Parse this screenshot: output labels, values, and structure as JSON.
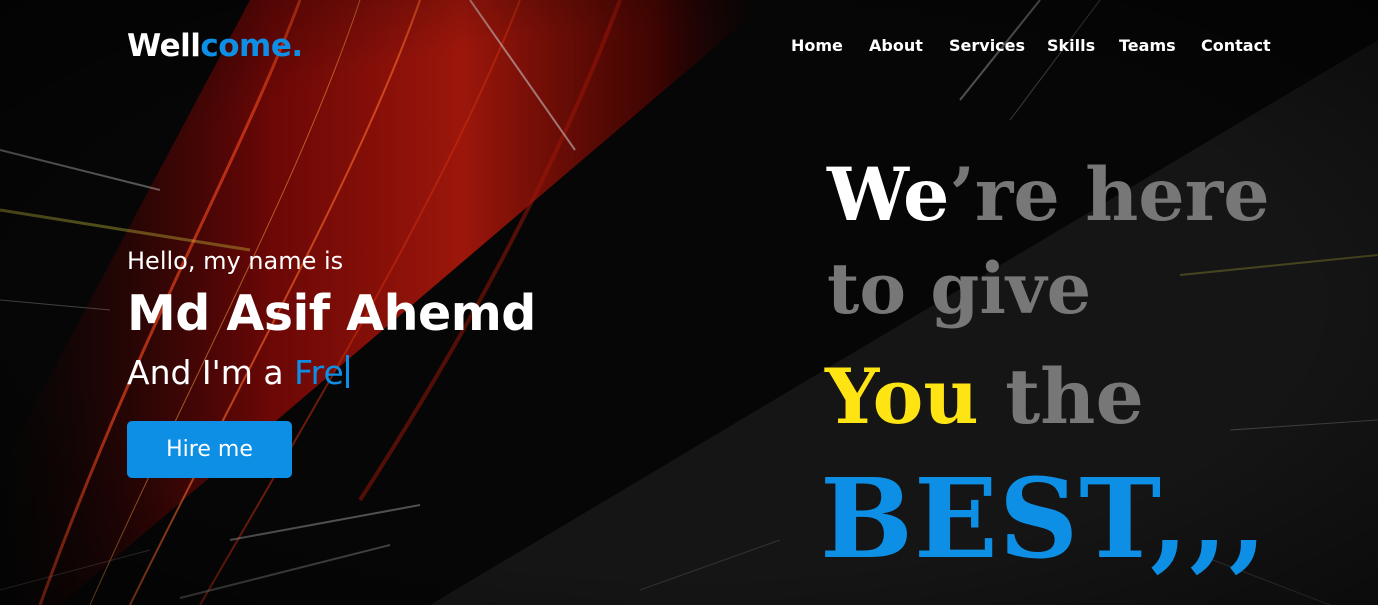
{
  "nav": {
    "logo_part1": "Well",
    "logo_part2": "come.",
    "menu": [
      "Home",
      "About",
      "Services",
      "Skills",
      "Teams",
      "Contact"
    ]
  },
  "hero": {
    "greeting": "Hello, my name is",
    "name": "Md Asif Ahemd",
    "role_prefix": "And I'm a",
    "role_typed": "Fre",
    "hire_button": "Hire me"
  },
  "tagline": {
    "line1_a": "We",
    "line1_b": "’re here",
    "line2": "to give",
    "line3_a": "You",
    "line3_b": "the",
    "line4": "BEST,,,"
  },
  "colors": {
    "accent": "#0e8fe6",
    "background": "#050505",
    "text": "#ffffff",
    "tagline_gray": "#777777",
    "tagline_yellow": "#ffe414"
  }
}
